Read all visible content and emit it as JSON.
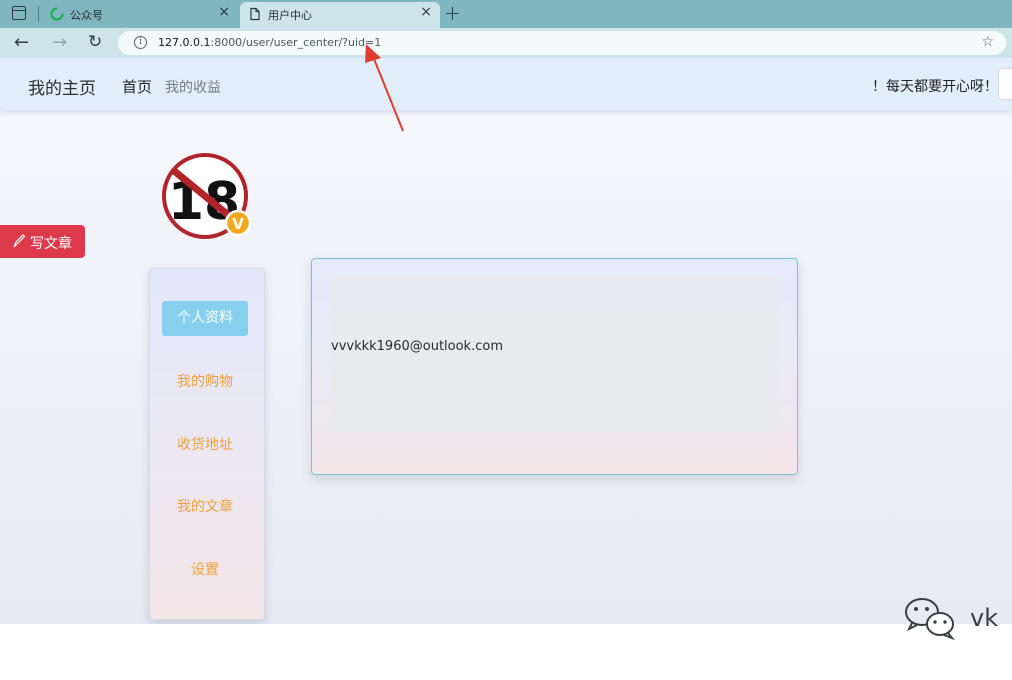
{
  "browser": {
    "tabs": [
      {
        "label": "公众号",
        "active": false
      },
      {
        "label": "用户中心",
        "active": true
      }
    ],
    "new_tab": "+",
    "close_glyph": "×",
    "url_host": "127.0.0.1",
    "url_rest": ":8000/user/user_center/?uid=1",
    "info_glyph": "i"
  },
  "nav": {
    "brand": "我的主页",
    "home": "首页",
    "income": "我的收益",
    "greeting": "！每天都要开心呀！"
  },
  "write_button": {
    "label": "写文章"
  },
  "sidebar": {
    "items": [
      {
        "label": "个人资料",
        "active": true
      },
      {
        "label": "我的购物",
        "active": false
      },
      {
        "label": "收货地址",
        "active": false
      },
      {
        "label": "我的文章",
        "active": false
      },
      {
        "label": "设置",
        "active": false
      }
    ]
  },
  "profile": {
    "email": "vvvkkk1960@outlook.com"
  },
  "avatar": {
    "badge_number": "18",
    "badge_letter": "V"
  },
  "watermark": {
    "text": "vk"
  },
  "colors": {
    "accent_red": "#dc3a4b",
    "menu_active_bg": "#86cfee",
    "menu_text": "#f0a03e",
    "card_border": "#7cc2cc",
    "tab_bar": "#7fb6c0",
    "annotation_arrow": "#e03c32"
  }
}
